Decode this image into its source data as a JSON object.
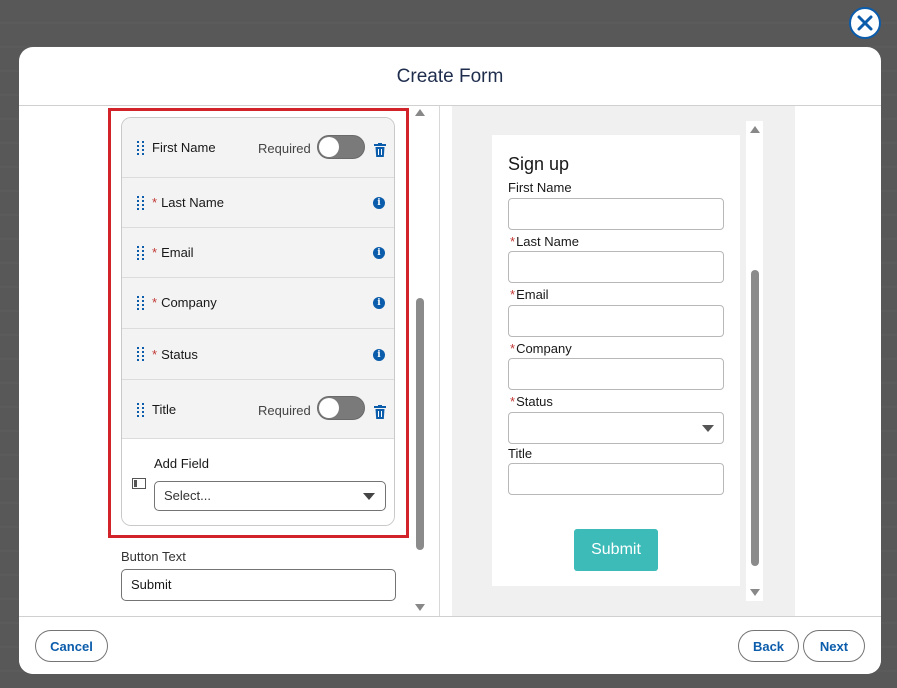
{
  "modal": {
    "title": "Create Form"
  },
  "fields": [
    {
      "label": "First Name",
      "required": false,
      "has_toggle": true,
      "required_label": "Required"
    },
    {
      "label": "Last Name",
      "required": true
    },
    {
      "label": "Email",
      "required": true
    },
    {
      "label": "Company",
      "required": true
    },
    {
      "label": "Status",
      "required": true
    },
    {
      "label": "Title",
      "required": false,
      "has_toggle": true,
      "required_label": "Required"
    }
  ],
  "add_field": {
    "label": "Add Field",
    "select_placeholder": "Select..."
  },
  "button_text": {
    "label": "Button Text",
    "value": "Submit"
  },
  "preview": {
    "title": "Sign up",
    "fields": [
      {
        "label": "First Name",
        "required": false,
        "type": "text"
      },
      {
        "label": "Last Name",
        "required": true,
        "type": "text"
      },
      {
        "label": "Email",
        "required": true,
        "type": "text"
      },
      {
        "label": "Company",
        "required": true,
        "type": "text"
      },
      {
        "label": "Status",
        "required": true,
        "type": "select"
      },
      {
        "label": "Title",
        "required": false,
        "type": "text"
      }
    ],
    "submit_label": "Submit",
    "submit_color": "#3cbbb9"
  },
  "footer": {
    "cancel_label": "Cancel",
    "back_label": "Back",
    "next_label": "Next"
  },
  "colors": {
    "accent": "#0b5cab",
    "required_star": "#c23934",
    "highlight_border": "#d2232a"
  }
}
